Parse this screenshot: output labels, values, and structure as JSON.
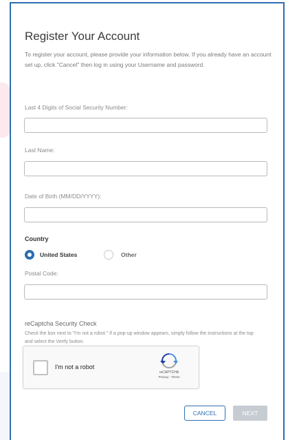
{
  "form": {
    "title": "Register Your Account",
    "intro": "To register your account, please provide your information below. If you already have an account set up, click \"Cancel\" then log in using your Username and password.",
    "fields": [
      {
        "label": "Last 4 Digits of Social Security Number:",
        "value": "",
        "placeholder": ""
      },
      {
        "label": "Last Name:",
        "value": "",
        "placeholder": ""
      },
      {
        "label": "Date of Birth (MM/DD/YYYY):",
        "value": "",
        "placeholder": ""
      },
      {
        "label": "Postal Code:",
        "value": "",
        "placeholder": ""
      }
    ],
    "country": {
      "label": "Country",
      "options": [
        {
          "label": "United States",
          "selected": true
        },
        {
          "label": "Other",
          "selected": false
        }
      ]
    },
    "recaptcha": {
      "title": "reCaptcha Security Check",
      "description": "Check the box next to \"I'm not a robot.\" If a pop-up window appears, simply follow the instructions at the top and select the Verify button.",
      "checkbox_label": "I'm not a robot",
      "brand": "reCAPTCHA",
      "links": "Privacy - Terms"
    },
    "buttons": {
      "cancel": "CANCEL",
      "next": "NEXT"
    }
  },
  "colors": {
    "accent": "#2d6db0",
    "disabled_button": "#c7ccd3"
  }
}
